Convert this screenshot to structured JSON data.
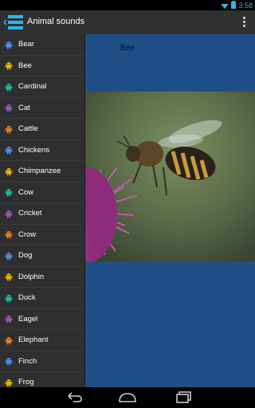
{
  "status": {
    "time": "3:58"
  },
  "app": {
    "title": "Animal sounds"
  },
  "detail": {
    "title": "Bee"
  },
  "drawer": {
    "items": [
      {
        "label": "Bear",
        "color": "#4a90e2"
      },
      {
        "label": "Bee",
        "color": "#e6b800"
      },
      {
        "label": "Cardinal",
        "color": "#1abc9c"
      },
      {
        "label": "Cat",
        "color": "#9b59b6"
      },
      {
        "label": "Cattle",
        "color": "#e67e22"
      },
      {
        "label": "Chickens",
        "color": "#4a90e2"
      },
      {
        "label": "Chimpanzee",
        "color": "#e6b800"
      },
      {
        "label": "Cow",
        "color": "#1abc9c"
      },
      {
        "label": "Cricket",
        "color": "#9b59b6"
      },
      {
        "label": "Crow",
        "color": "#e67e22"
      },
      {
        "label": "Dog",
        "color": "#4a90e2"
      },
      {
        "label": "Dolphin",
        "color": "#e6b800"
      },
      {
        "label": "Duck",
        "color": "#1abc9c"
      },
      {
        "label": "Eagel",
        "color": "#9b59b6"
      },
      {
        "label": "Elephant",
        "color": "#e67e22"
      },
      {
        "label": "Finch",
        "color": "#4a90e2"
      },
      {
        "label": "Frog",
        "color": "#e6b800"
      }
    ]
  },
  "colors": {
    "accent": "#33b5e5",
    "detail_background": "#1f4f86",
    "drawer_background": "#2f2f31"
  }
}
